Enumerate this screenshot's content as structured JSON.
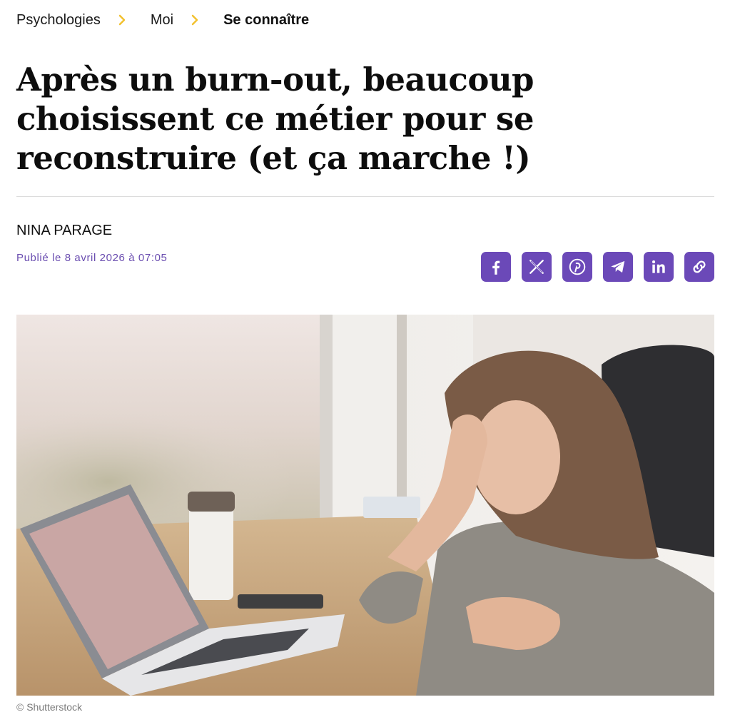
{
  "breadcrumb": {
    "items": [
      {
        "label": "Psychologies"
      },
      {
        "label": "Moi"
      },
      {
        "label": "Se connaître"
      }
    ]
  },
  "article": {
    "title": "Après un burn-out, beaucoup choisissent ce métier pour se reconstruire (et ça marche !)",
    "author": "NINA PARAGE",
    "published": "Publié le 8 avril 2026 à 07:05",
    "image_credit": "© Shutterstock"
  },
  "share": {
    "buttons": [
      {
        "icon": "facebook-icon"
      },
      {
        "icon": "x-icon"
      },
      {
        "icon": "pinterest-icon"
      },
      {
        "icon": "telegram-icon"
      },
      {
        "icon": "linkedin-icon"
      },
      {
        "icon": "link-icon"
      }
    ]
  },
  "colors": {
    "accent": "#6b49b8",
    "breadcrumb_separator": "#f2c12e",
    "published_text": "#6a4db0"
  }
}
